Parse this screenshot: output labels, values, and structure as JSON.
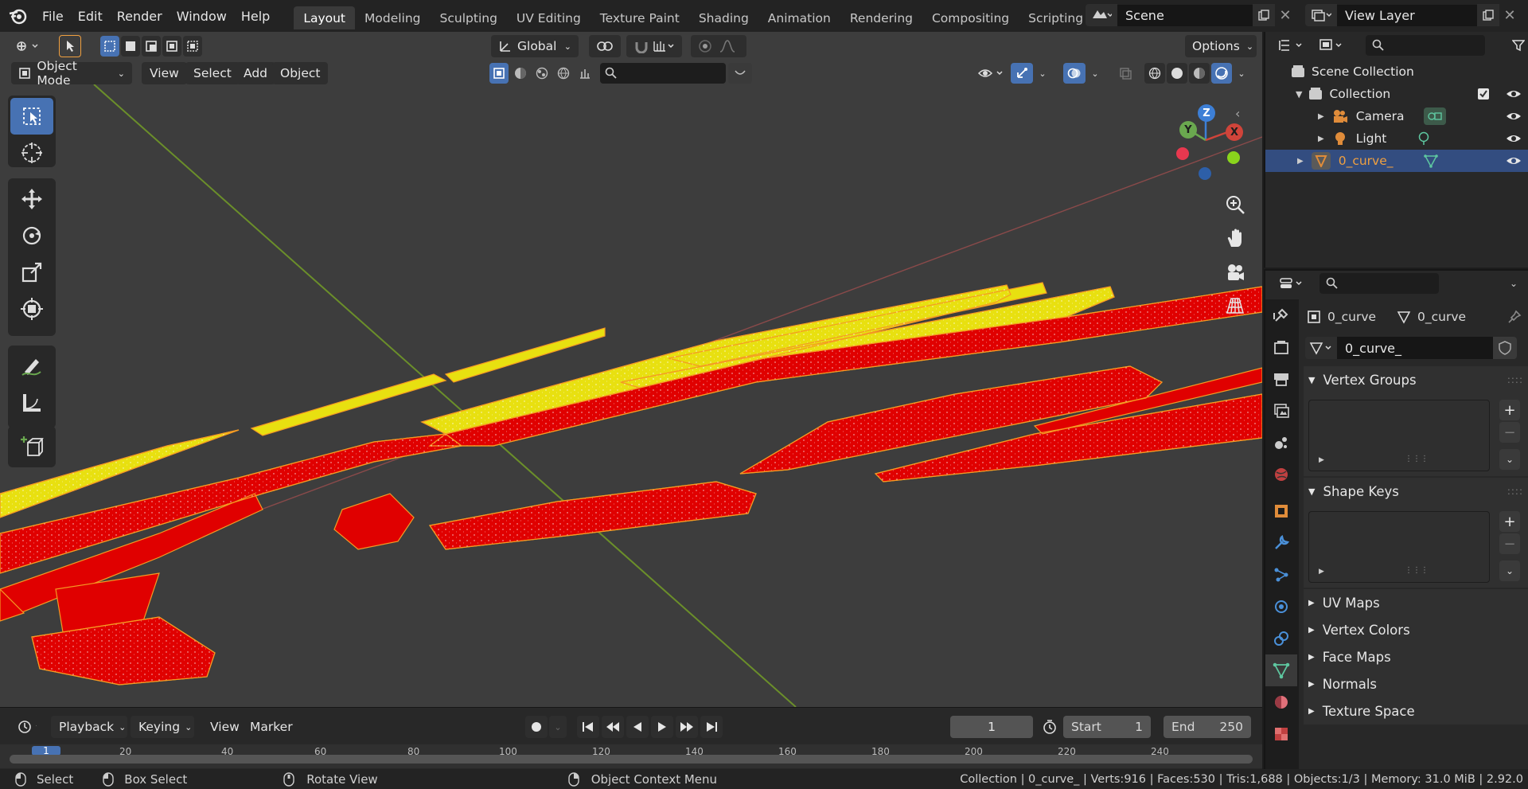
{
  "topbar": {
    "menus": [
      "File",
      "Edit",
      "Render",
      "Window",
      "Help"
    ],
    "workspaces": [
      "Layout",
      "Modeling",
      "Sculpting",
      "UV Editing",
      "Texture Paint",
      "Shading",
      "Animation",
      "Rendering",
      "Compositing",
      "Scripting"
    ],
    "active_workspace": "Layout",
    "scene_name": "Scene",
    "view_layer_name": "View Layer"
  },
  "viewport_header": {
    "orientation": "Global",
    "options_label": "Options",
    "mode_label": "Object Mode",
    "menus": [
      "View",
      "Select",
      "Add",
      "Object"
    ]
  },
  "gizmo": {
    "x": "X",
    "y": "Y",
    "z": "Z"
  },
  "outliner": {
    "root": "Scene Collection",
    "collection": "Collection",
    "items": [
      {
        "label": "Camera",
        "icon": "camera-icon",
        "selected": false
      },
      {
        "label": "Light",
        "icon": "light-icon",
        "selected": false
      },
      {
        "label": "0_curve_",
        "icon": "mesh-icon",
        "selected": true
      }
    ]
  },
  "properties": {
    "object_name": "0_curve",
    "data_name": "0_curve",
    "mesh_field": "0_curve_",
    "panels": {
      "vertex_groups": "Vertex Groups",
      "shape_keys": "Shape Keys",
      "uv_maps": "UV Maps",
      "vertex_colors": "Vertex Colors",
      "face_maps": "Face Maps",
      "normals": "Normals",
      "texture_space": "Texture Space"
    }
  },
  "timeline": {
    "menus": [
      "Playback",
      "Keying",
      "View",
      "Marker"
    ],
    "current_frame": "1",
    "start_label": "Start",
    "start_value": "1",
    "end_label": "End",
    "end_value": "250",
    "ruler_labels": [
      "1",
      "20",
      "40",
      "60",
      "80",
      "100",
      "120",
      "140",
      "160",
      "180",
      "200",
      "220",
      "240"
    ]
  },
  "statusbar": {
    "select": "Select",
    "box_select": "Box Select",
    "rotate_view": "Rotate View",
    "context_menu": "Object Context Menu",
    "stats": "Collection | 0_curve_ | Verts:916 | Faces:530 | Tris:1,688 | Objects:1/3 | Memory: 31.0 MiB | 2.92.0"
  },
  "colors": {
    "accent": "#4772b3",
    "selected_row": "#334d80",
    "object_red": "#e00000",
    "object_yellow": "#f0e010",
    "outline": "#f59a23"
  }
}
